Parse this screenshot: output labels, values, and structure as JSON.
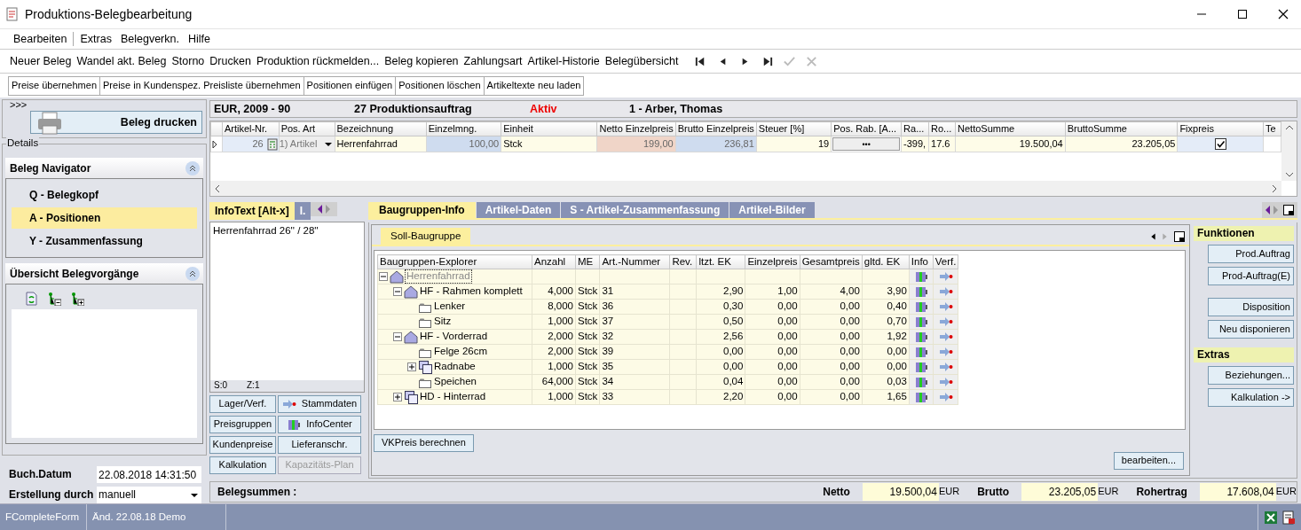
{
  "window": {
    "title": "Produktions-Belegbearbeitung"
  },
  "menu": [
    "Bearbeiten",
    "Extras",
    "Belegverkn.",
    "Hilfe"
  ],
  "toolbar": {
    "buttons": [
      "Neuer Beleg",
      "Wandel akt. Beleg",
      "Storno",
      "Drucken",
      "Produktion rückmelden...",
      "Beleg kopieren",
      "Zahlungsart",
      "Artikel-Historie",
      "Belegübersicht"
    ],
    "nav": [
      {
        "kind": "first",
        "disabled": false
      },
      {
        "kind": "previous",
        "disabled": false
      },
      {
        "kind": "next",
        "disabled": false
      },
      {
        "kind": "last",
        "disabled": false
      },
      {
        "kind": "confirm",
        "disabled": true
      },
      {
        "kind": "cancel",
        "disabled": true
      }
    ]
  },
  "actions": [
    "Preise übernehmen",
    "Preise in Kundenspez. Preisliste übernehmen",
    "Positionen einfügen",
    "Positionen löschen",
    "Artikeltexte neu laden"
  ],
  "left": {
    "expander": ">>>",
    "print_button": "Beleg drucken",
    "details_label": "Details",
    "navigator": {
      "title": "Beleg Navigator",
      "items": [
        {
          "label": "Q - Belegkopf",
          "selected": false
        },
        {
          "label": "A - Positionen",
          "selected": true
        },
        {
          "label": "Y - Zusammenfassung",
          "selected": false
        }
      ]
    },
    "overview": {
      "title": "Übersicht Belegvorgänge"
    },
    "fields": [
      {
        "label": "Buch.Datum",
        "value": "22.08.2018 14:31:50",
        "kind": "text"
      },
      {
        "label": "Erstellung durch",
        "value": "manuell",
        "kind": "select"
      }
    ]
  },
  "header": {
    "period": "EUR, 2009 - 90",
    "document": "27 Produktionsauftrag",
    "status": "Aktiv",
    "customer": "1 - Arber, Thomas"
  },
  "positions": {
    "columns": [
      {
        "label": "Artikel-Nr.",
        "kind": "number"
      },
      {
        "label": "Pos. Art",
        "kind": "select"
      },
      {
        "label": "Bezeichnung",
        "kind": "text"
      },
      {
        "label": "Einzelmng.",
        "kind": "number"
      },
      {
        "label": "Einheit",
        "kind": "text"
      },
      {
        "label": "Netto Einzelpreis",
        "kind": "number"
      },
      {
        "label": "Brutto Einzelpreis",
        "kind": "number"
      },
      {
        "label": "Steuer [%]",
        "kind": "number"
      },
      {
        "label": "Pos. Rab. [A...",
        "kind": "button"
      },
      {
        "label": "Ra...",
        "kind": "text"
      },
      {
        "label": "Ro...",
        "kind": "text"
      },
      {
        "label": "NettoSumme",
        "kind": "number"
      },
      {
        "label": "BruttoSumme",
        "kind": "number"
      },
      {
        "label": "Fixpreis",
        "kind": "check"
      },
      {
        "label": "Te"
      }
    ],
    "rows": [
      {
        "selected": true,
        "cells": [
          "26",
          "1) Artikel",
          "Herrenfahrrad",
          "100,00",
          "Stck",
          "199,00",
          "236,81",
          "19",
          "•••",
          "-399,",
          "17.6",
          "19.500,04",
          "23.205,05",
          {
            "checked": true
          }
        ]
      }
    ]
  },
  "infotext": {
    "tabs": [
      {
        "label": "InfoText [Alt-x]",
        "selected": true
      },
      {
        "label": "I.",
        "selected": false
      }
    ],
    "text": "Herrenfahrrad 26'' / 28''",
    "status": [
      "S:0",
      "Z:1"
    ],
    "buttons": [
      {
        "label": "Lager/Verf.",
        "kind": "plain",
        "disabled": false
      },
      {
        "label": "Stammdaten",
        "kind": "transfer",
        "disabled": false
      },
      {
        "label": "Preisgruppen",
        "kind": "plain",
        "disabled": false
      },
      {
        "label": "InfoCenter",
        "kind": "info",
        "disabled": false
      },
      {
        "label": "Kundenpreise",
        "kind": "plain",
        "disabled": false
      },
      {
        "label": "Lieferanschr.",
        "kind": "plain",
        "disabled": false
      },
      {
        "label": "Kalkulation",
        "kind": "plain",
        "disabled": false
      },
      {
        "label": "Kapazitäts-Plan",
        "kind": "plain",
        "disabled": true
      }
    ]
  },
  "detail_tabs": [
    {
      "label": "Baugruppen-Info",
      "selected": true
    },
    {
      "label": "Artikel-Daten",
      "selected": false
    },
    {
      "label": "S - Artikel-Zusammenfassung",
      "selected": false
    },
    {
      "label": "Artikel-Bilder",
      "selected": false
    }
  ],
  "subtabs": [
    {
      "label": "Soll-Baugruppe",
      "selected": true
    }
  ],
  "bom": {
    "columns": [
      "Baugruppen-Explorer",
      "Anzahl",
      "ME",
      "Art.-Nummer",
      "Rev.",
      "ltzt. EK",
      "Einzelpreis",
      "Gesamtpreis",
      "gltd. EK",
      "Info",
      "Verf."
    ],
    "rows": [
      {
        "name": "Herrenfahrrad",
        "kind": "assembly",
        "expanded": true,
        "focused": true,
        "children": [
          {
            "name": "HF - Rahmen komplett",
            "kind": "assembly",
            "expanded": true,
            "focused": false,
            "values": [
              "4,000",
              "Stck",
              "31",
              "2,90",
              "1,00",
              "4,00",
              "3,90"
            ],
            "children": [
              {
                "name": "Lenker",
                "kind": "part",
                "focused": false,
                "values": [
                  "8,000",
                  "Stck",
                  "36",
                  "0,30",
                  "0,00",
                  "0,00",
                  "0,40"
                ]
              },
              {
                "name": "Sitz",
                "kind": "part",
                "focused": false,
                "values": [
                  "1,000",
                  "Stck",
                  "37",
                  "0,50",
                  "0,00",
                  "0,00",
                  "0,70"
                ]
              }
            ]
          },
          {
            "name": "HF - Vorderrad",
            "kind": "assembly",
            "expanded": true,
            "focused": false,
            "values": [
              "2,000",
              "Stck",
              "32",
              "2,56",
              "0,00",
              "0,00",
              "1,92"
            ],
            "children": [
              {
                "name": "Felge 26cm",
                "kind": "part",
                "focused": false,
                "values": [
                  "2,000",
                  "Stck",
                  "39",
                  "0,00",
                  "0,00",
                  "0,00",
                  "0,00"
                ]
              },
              {
                "name": "Radnabe",
                "kind": "linked",
                "expanded": false,
                "focused": false,
                "values": [
                  "1,000",
                  "Stck",
                  "35",
                  "0,00",
                  "0,00",
                  "0,00",
                  "0,00"
                ]
              },
              {
                "name": "Speichen",
                "kind": "part",
                "focused": false,
                "values": [
                  "64,000",
                  "Stck",
                  "34",
                  "0,04",
                  "0,00",
                  "0,00",
                  "0,03"
                ]
              }
            ]
          },
          {
            "name": "HD - Hinterrad",
            "kind": "linked",
            "expanded": false,
            "focused": false,
            "values": [
              "1,000",
              "Stck",
              "33",
              "2,20",
              "0,00",
              "0,00",
              "1,65"
            ]
          }
        ]
      }
    ],
    "calc_button": "VKPreis berechnen",
    "edit_button": "bearbeiten..."
  },
  "functions": [
    {
      "title": "Funktionen",
      "clusters": [
        [
          "Prod.Auftrag",
          "Prod-Auftrag(E)"
        ],
        [
          "Disposition",
          "Neu disponieren"
        ]
      ]
    },
    {
      "title": "Extras",
      "clusters": [
        [
          "Beziehungen...",
          "Kalkulation ->"
        ]
      ]
    }
  ],
  "totals": {
    "label": "Belegsummen :",
    "items": [
      {
        "label": "Netto",
        "value": "19.500,04",
        "currency": "EUR"
      },
      {
        "label": "Brutto",
        "value": "23.205,05",
        "currency": "EUR"
      },
      {
        "label": "Rohertrag",
        "value": "17.608,04",
        "currency": "EUR"
      }
    ]
  },
  "status_bar": [
    "FCompleteForm",
    "Änd. 22.08.18 Demo"
  ]
}
